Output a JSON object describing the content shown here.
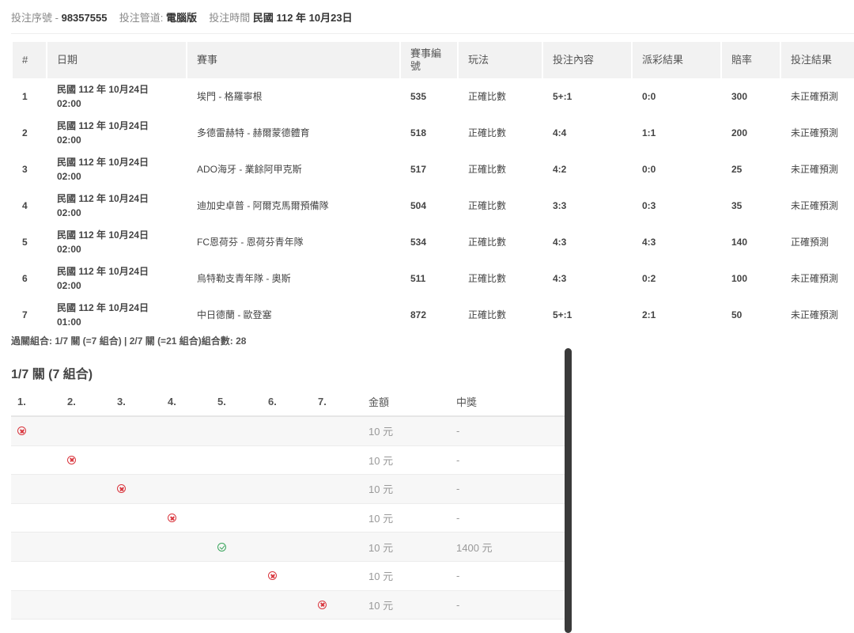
{
  "bet_info": {
    "serial_label": "投注序號",
    "serial_value": "98357555",
    "channel_label": "投注管道:",
    "channel_value": "電腦版",
    "time_label": "投注時間",
    "time_value": "民國 112 年 10月23日"
  },
  "matches_table": {
    "headers": [
      "#",
      "日期",
      "賽事",
      "賽事編號",
      "玩法",
      "投注內容",
      "派彩結果",
      "賠率",
      "投注結果"
    ],
    "rows": [
      {
        "no": "1",
        "date": "民國 112 年 10月24日",
        "time": "02:00",
        "match": "埃門 - 格羅寧根",
        "match_id": "535",
        "play": "正確比數",
        "bet": "5+:1",
        "result": "0:0",
        "odds": "300",
        "outcome": "未正確預測"
      },
      {
        "no": "2",
        "date": "民國 112 年 10月24日",
        "time": "02:00",
        "match": "多德雷赫特 - 赫爾蒙德體育",
        "match_id": "518",
        "play": "正確比數",
        "bet": "4:4",
        "result": "1:1",
        "odds": "200",
        "outcome": "未正確預測"
      },
      {
        "no": "3",
        "date": "民國 112 年 10月24日",
        "time": "02:00",
        "match": "ADO海牙 - 業餘阿甲克斯",
        "match_id": "517",
        "play": "正確比數",
        "bet": "4:2",
        "result": "0:0",
        "odds": "25",
        "outcome": "未正確預測"
      },
      {
        "no": "4",
        "date": "民國 112 年 10月24日",
        "time": "02:00",
        "match": "迪加史卓普 - 阿爾克馬爾預備隊",
        "match_id": "504",
        "play": "正確比數",
        "bet": "3:3",
        "result": "0:3",
        "odds": "35",
        "outcome": "未正確預測"
      },
      {
        "no": "5",
        "date": "民國 112 年 10月24日",
        "time": "02:00",
        "match": "FC恩荷芬 - 恩荷芬青年隊",
        "match_id": "534",
        "play": "正確比數",
        "bet": "4:3",
        "result": "4:3",
        "odds": "140",
        "outcome": "正確預測"
      },
      {
        "no": "6",
        "date": "民國 112 年 10月24日",
        "time": "02:00",
        "match": "烏特勒支青年隊 - 奧斯",
        "match_id": "511",
        "play": "正確比數",
        "bet": "4:3",
        "result": "0:2",
        "odds": "100",
        "outcome": "未正確預測"
      },
      {
        "no": "7",
        "date": "民國 112 年 10月24日",
        "time": "01:00",
        "match": "中日德蘭 - 歐登塞",
        "match_id": "872",
        "play": "正確比數",
        "bet": "5+:1",
        "result": "2:1",
        "odds": "50",
        "outcome": "未正確預測"
      }
    ]
  },
  "combo_summary": "過關組合: 1/7 關 (=7 組合) | 2/7 關 (=21 組合)組合數: 28",
  "section_title": "1/7 關 (7 組合)",
  "combo_table": {
    "headers": [
      "1.",
      "2.",
      "3.",
      "4.",
      "5.",
      "6.",
      "7.",
      "金額",
      "中獎"
    ],
    "rows": [
      {
        "col": 0,
        "status": "fail-icon",
        "amount": "10 元",
        "prize": "-"
      },
      {
        "col": 1,
        "status": "fail-icon",
        "amount": "10 元",
        "prize": "-"
      },
      {
        "col": 2,
        "status": "fail-icon",
        "amount": "10 元",
        "prize": "-"
      },
      {
        "col": 3,
        "status": "fail-icon",
        "amount": "10 元",
        "prize": "-"
      },
      {
        "col": 4,
        "status": "check-icon",
        "amount": "10 元",
        "prize": "1400 元"
      },
      {
        "col": 5,
        "status": "fail-icon",
        "amount": "10 元",
        "prize": "-"
      },
      {
        "col": 6,
        "status": "fail-icon",
        "amount": "10 元",
        "prize": "-"
      }
    ]
  },
  "colors": {
    "fail": "#d9363e",
    "success": "#3ba55d",
    "header_bg": "#f2f2f2"
  }
}
